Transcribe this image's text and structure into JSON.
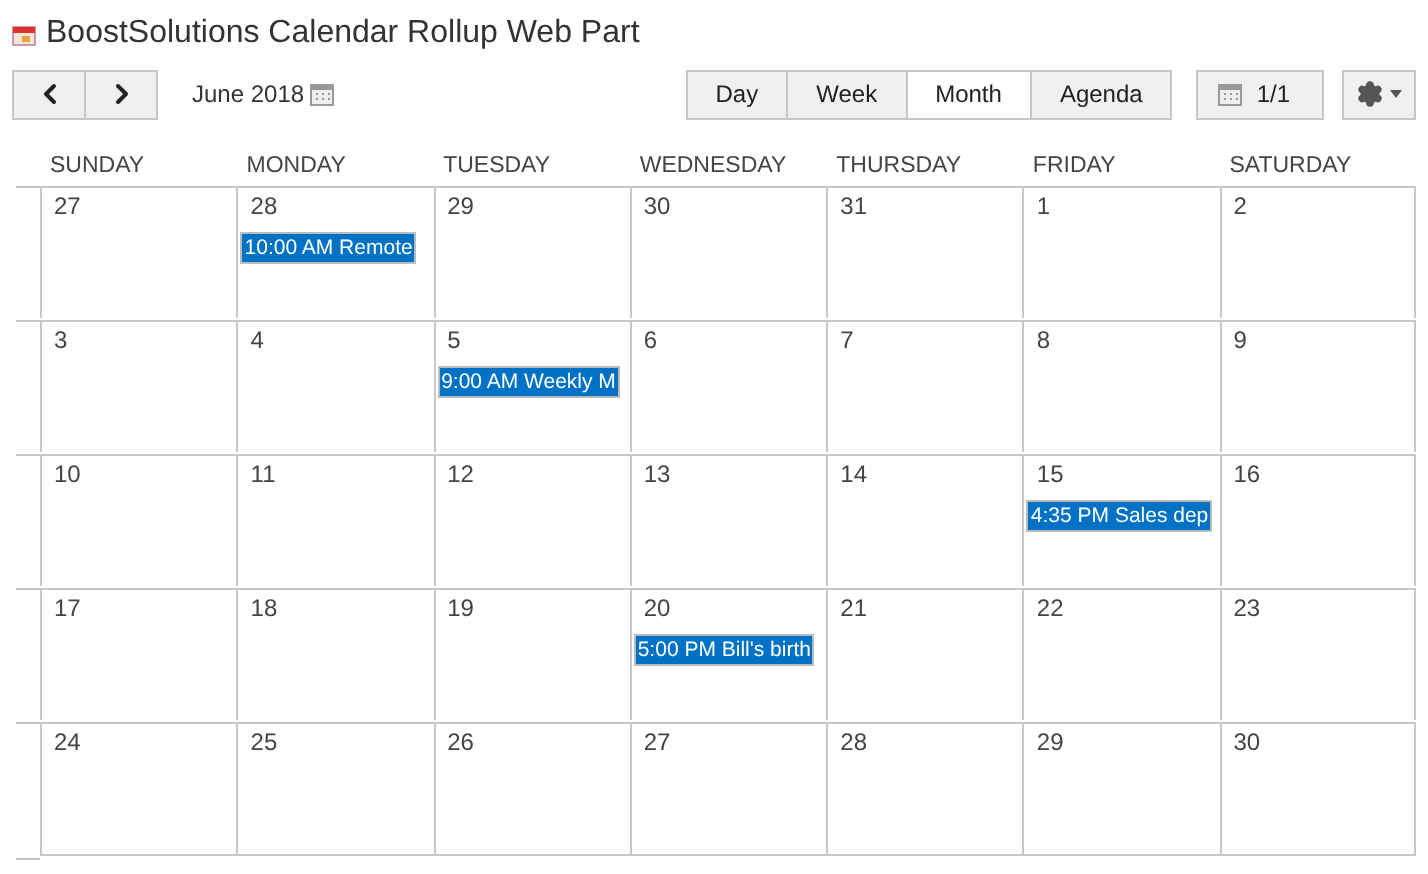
{
  "title": "BoostSolutions Calendar Rollup Web Part",
  "toolbar": {
    "date_label": "June 2018",
    "views": [
      {
        "label": "Day",
        "selected": false
      },
      {
        "label": "Week",
        "selected": false
      },
      {
        "label": "Month",
        "selected": true
      },
      {
        "label": "Agenda",
        "selected": false
      }
    ],
    "page": "1/1"
  },
  "weekdays": [
    "SUNDAY",
    "MONDAY",
    "TUESDAY",
    "WEDNESDAY",
    "THURSDAY",
    "FRIDAY",
    "SATURDAY"
  ],
  "weeks": [
    [
      {
        "day": "27"
      },
      {
        "day": "28",
        "event": "10:00 AM Remote"
      },
      {
        "day": "29"
      },
      {
        "day": "30"
      },
      {
        "day": "31"
      },
      {
        "day": "1"
      },
      {
        "day": "2"
      }
    ],
    [
      {
        "day": "3"
      },
      {
        "day": "4"
      },
      {
        "day": "5",
        "event": "9:00 AM Weekly M"
      },
      {
        "day": "6"
      },
      {
        "day": "7"
      },
      {
        "day": "8"
      },
      {
        "day": "9"
      }
    ],
    [
      {
        "day": "10"
      },
      {
        "day": "11"
      },
      {
        "day": "12"
      },
      {
        "day": "13"
      },
      {
        "day": "14"
      },
      {
        "day": "15",
        "event": "4:35 PM Sales dep"
      },
      {
        "day": "16"
      }
    ],
    [
      {
        "day": "17"
      },
      {
        "day": "18"
      },
      {
        "day": "19"
      },
      {
        "day": "20",
        "event": "5:00 PM Bill's birth"
      },
      {
        "day": "21"
      },
      {
        "day": "22"
      },
      {
        "day": "23"
      }
    ],
    [
      {
        "day": "24"
      },
      {
        "day": "25"
      },
      {
        "day": "26"
      },
      {
        "day": "27"
      },
      {
        "day": "28"
      },
      {
        "day": "29"
      },
      {
        "day": "30"
      }
    ]
  ]
}
